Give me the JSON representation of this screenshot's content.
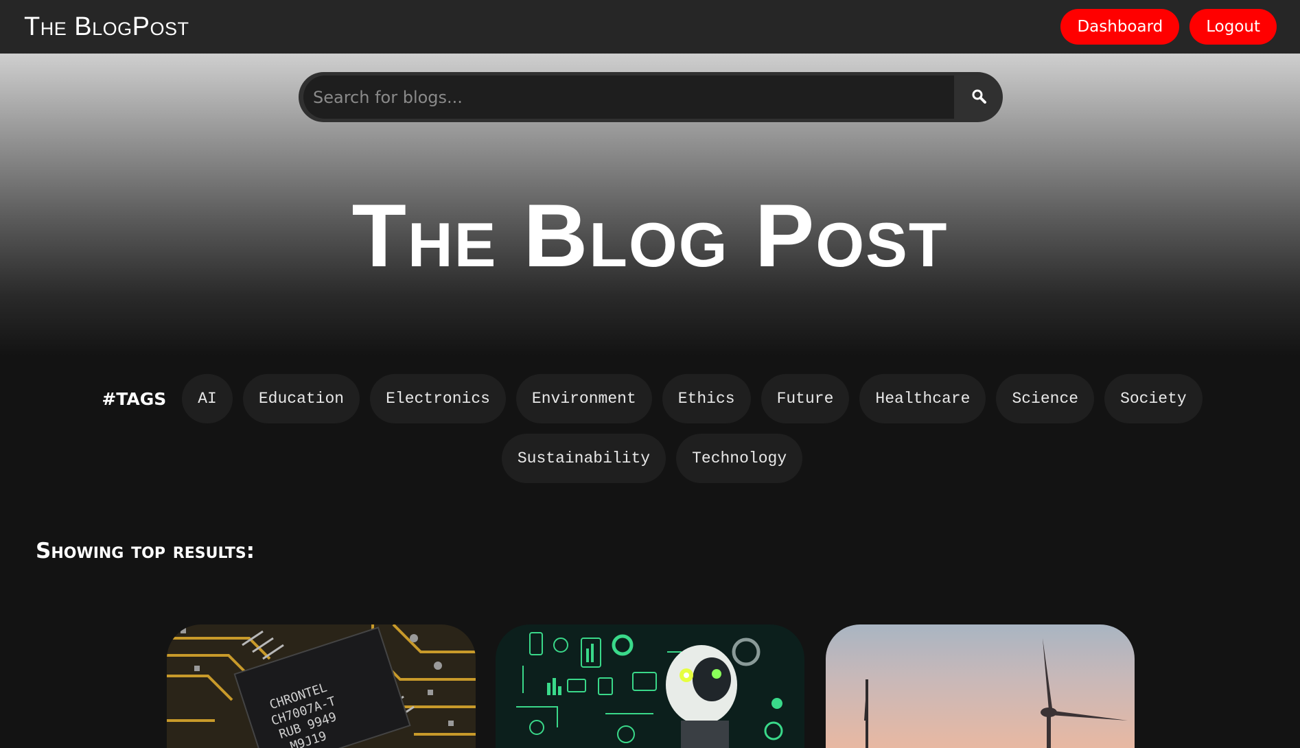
{
  "navbar": {
    "brand": "The BlogPost",
    "dashboard_label": "Dashboard",
    "logout_label": "Logout",
    "accent_color": "#ff0000"
  },
  "search": {
    "placeholder": "Search for blogs...",
    "icon": "search-icon"
  },
  "hero": {
    "title": "The Blog Post"
  },
  "tags": {
    "label": "#TAGS",
    "items": [
      "AI",
      "Education",
      "Electronics",
      "Environment",
      "Ethics",
      "Future",
      "Healthcare",
      "Science",
      "Society",
      "Sustainability",
      "Technology"
    ]
  },
  "results": {
    "heading": "Showing top results:",
    "cards": [
      {
        "image": "circuit-board-chip-image",
        "chip_text": [
          "CHRONTEL",
          "CH7007A-T",
          "RUB 9949",
          "M9J19"
        ]
      },
      {
        "image": "ai-robot-dashboard-image"
      },
      {
        "image": "wind-turbine-sunset-image"
      }
    ]
  }
}
